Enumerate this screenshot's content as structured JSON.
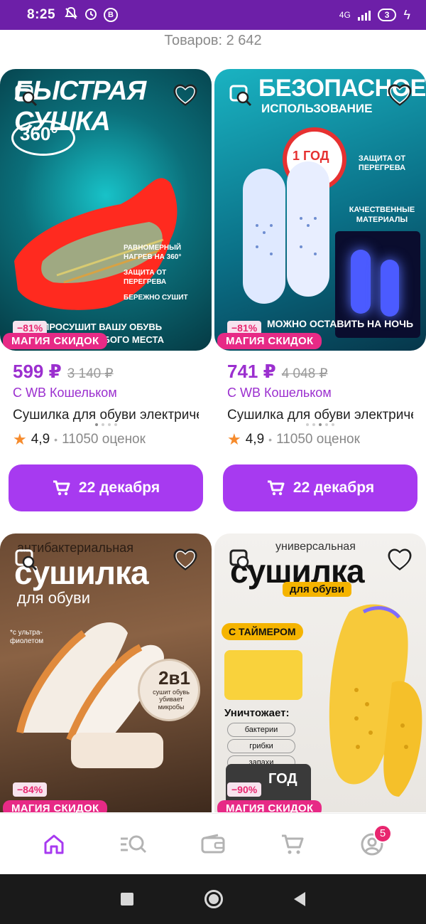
{
  "status_bar": {
    "time": "8:25",
    "network": "4G",
    "battery": "3"
  },
  "catalog": {
    "count_label": "Товаров: 2 642"
  },
  "products": [
    {
      "discount": "−81%",
      "promo": "МАГИЯ СКИДОК",
      "price": "599 ₽",
      "old_price": "3 140 ₽",
      "wallet": "С WB Кошельком",
      "name": "Сушилка для обуви электрическая",
      "rating": "4,9",
      "reviews": "11050 оценок",
      "delivery": "22 декабря",
      "image_headline": "БЫСТРАЯ СУШКА",
      "image_badge": "360°",
      "image_caption": "ПРОСУШИТ ВАШУ ОБУВЬ",
      "image_caption2": "ДО ЛЮБОГО МЕСТА",
      "image_feature1": "РАВНОМЕРНЫЙ НАГРЕВ НА 360°",
      "image_feature2": "ЗАЩИТА ОТ ПЕРЕГРЕВА",
      "image_feature3": "БЕРЕЖНО СУШИТ"
    },
    {
      "discount": "−81%",
      "promo": "МАГИЯ СКИДОК",
      "price": "741 ₽",
      "old_price": "4 048 ₽",
      "wallet": "С WB Кошельком",
      "name": "Сушилка для обуви электрическая",
      "rating": "4,9",
      "reviews": "11050 оценок",
      "delivery": "22 декабря",
      "image_headline": "БЕЗОПАСНОЕ",
      "image_subheadline": "ИСПОЛЬЗОВАНИЕ",
      "image_badge": "1 ГОД",
      "image_caption": "МОЖНО ОСТАВИТЬ НА НОЧЬ",
      "image_feature1": "ЗАЩИТА ОТ ПЕРЕГРЕВА",
      "image_feature2": "КАЧЕСТВЕННЫЕ МАТЕРИАЛЫ"
    },
    {
      "discount": "−84%",
      "promo": "МАГИЯ СКИДОК",
      "image_headline": "сушилка",
      "image_subheadline": "антибактериальная",
      "image_sub2": "для обуви",
      "image_note": "*с ультра-фиолетом",
      "image_badge": "2в1",
      "image_badge_text": "сушит обувь убивает микробы"
    },
    {
      "discount": "−90%",
      "promo": "МАГИЯ СКИДОК",
      "image_headline": "сушилка",
      "image_subheadline": "универсальная",
      "image_sub2": "для обуви",
      "image_badge": "С ТАЙМЕРОМ",
      "image_kills": "Уничтожает:",
      "image_kill1": "бактерии",
      "image_kill2": "грибки",
      "image_kill3": "запахи",
      "image_year": "ГОД"
    }
  ],
  "bottom_nav": {
    "profile_badge": "5"
  },
  "colors": {
    "brand": "#6d1fa8",
    "accent": "#a73af0",
    "price": "#9b2fcf",
    "promo": "#e72a86"
  }
}
